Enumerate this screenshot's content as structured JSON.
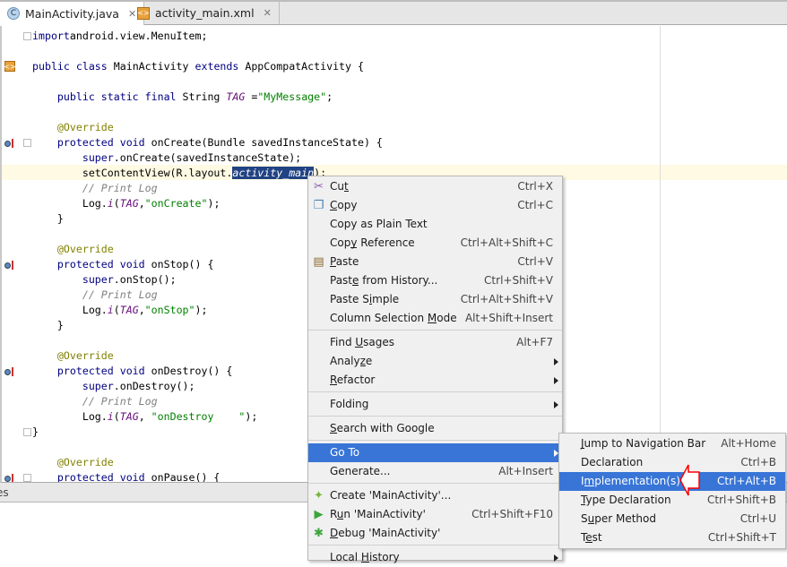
{
  "tabs": [
    {
      "label": "MainActivity.java",
      "icon": "java-class-icon",
      "active": true
    },
    {
      "label": "activity_main.xml",
      "icon": "xml-layout-icon",
      "active": false
    }
  ],
  "code": [
    {
      "row": 0,
      "t": [
        [
          "kw",
          "import"
        ],
        [
          "",
          "android.view.MenuItem;"
        ]
      ]
    },
    {
      "row": 2,
      "t": [
        [
          "kw",
          "public class "
        ],
        [
          "",
          "MainActivity "
        ],
        [
          "kw",
          "extends "
        ],
        [
          "",
          "AppCompatActivity {"
        ]
      ]
    },
    {
      "row": 4,
      "t": [
        [
          "",
          "    "
        ],
        [
          "kw",
          "public static final "
        ],
        [
          "",
          "String "
        ],
        [
          "tag",
          "TAG"
        ],
        [
          "",
          " ="
        ],
        [
          "str",
          "\"MyMessage\""
        ],
        [
          "",
          ";"
        ]
      ]
    },
    {
      "row": 6,
      "t": [
        [
          "",
          "    "
        ],
        [
          "ann",
          "@Override"
        ]
      ]
    },
    {
      "row": 7,
      "t": [
        [
          "",
          "    "
        ],
        [
          "kw",
          "protected void "
        ],
        [
          "",
          "onCreate(Bundle savedInstanceState) {"
        ]
      ]
    },
    {
      "row": 8,
      "t": [
        [
          "",
          "        "
        ],
        [
          "kw",
          "super"
        ],
        [
          "",
          ".onCreate(savedInstanceState);"
        ]
      ]
    },
    {
      "row": 9,
      "t": [
        [
          "",
          "        setContentView(R.layout."
        ],
        [
          "sel",
          "activity_main"
        ],
        [
          "",
          ");"
        ]
      ]
    },
    {
      "row": 10,
      "t": [
        [
          "",
          "        "
        ],
        [
          "cm",
          "// Print Log"
        ]
      ]
    },
    {
      "row": 11,
      "t": [
        [
          "",
          "        Log."
        ],
        [
          "tag",
          "i"
        ],
        [
          "",
          "("
        ],
        [
          "tag",
          "TAG"
        ],
        [
          "",
          ","
        ],
        [
          "str",
          "\"onCreate\""
        ],
        [
          "",
          ");"
        ]
      ]
    },
    {
      "row": 12,
      "t": [
        [
          "",
          "    }"
        ]
      ]
    },
    {
      "row": 14,
      "t": [
        [
          "",
          "    "
        ],
        [
          "ann",
          "@Override"
        ]
      ]
    },
    {
      "row": 15,
      "t": [
        [
          "",
          "    "
        ],
        [
          "kw",
          "protected void "
        ],
        [
          "",
          "onStop() {"
        ]
      ]
    },
    {
      "row": 16,
      "t": [
        [
          "",
          "        "
        ],
        [
          "kw",
          "super"
        ],
        [
          "",
          ".onStop();"
        ]
      ]
    },
    {
      "row": 17,
      "t": [
        [
          "",
          "        "
        ],
        [
          "cm",
          "// Print Log"
        ]
      ]
    },
    {
      "row": 18,
      "t": [
        [
          "",
          "        Log."
        ],
        [
          "tag",
          "i"
        ],
        [
          "",
          "("
        ],
        [
          "tag",
          "TAG"
        ],
        [
          "",
          ","
        ],
        [
          "str",
          "\"onStop\""
        ],
        [
          "",
          ");"
        ]
      ]
    },
    {
      "row": 19,
      "t": [
        [
          "",
          "    }"
        ]
      ]
    },
    {
      "row": 21,
      "t": [
        [
          "",
          "    "
        ],
        [
          "ann",
          "@Override"
        ]
      ]
    },
    {
      "row": 22,
      "t": [
        [
          "",
          "    "
        ],
        [
          "kw",
          "protected void "
        ],
        [
          "",
          "onDestroy() {"
        ]
      ]
    },
    {
      "row": 23,
      "t": [
        [
          "",
          "        "
        ],
        [
          "kw",
          "super"
        ],
        [
          "",
          ".onDestroy();"
        ]
      ]
    },
    {
      "row": 24,
      "t": [
        [
          "",
          "        "
        ],
        [
          "cm",
          "// Print Log"
        ]
      ]
    },
    {
      "row": 25,
      "t": [
        [
          "",
          "        Log."
        ],
        [
          "tag",
          "i"
        ],
        [
          "",
          "("
        ],
        [
          "tag",
          "TAG"
        ],
        [
          "",
          ", "
        ],
        [
          "str",
          "\"onDestroy    \""
        ],
        [
          "",
          ");"
        ]
      ]
    },
    {
      "row": 26,
      "t": [
        [
          "",
          "}"
        ]
      ]
    },
    {
      "row": 28,
      "t": [
        [
          "",
          "    "
        ],
        [
          "ann",
          "@Override"
        ]
      ]
    },
    {
      "row": 29,
      "t": [
        [
          "",
          "    "
        ],
        [
          "kw",
          "protected void "
        ],
        [
          "",
          "onPause() {"
        ]
      ]
    }
  ],
  "gutter": {
    "override_rows": [
      7,
      15,
      22,
      29
    ],
    "fold_rows": [
      0,
      7,
      26,
      29
    ],
    "layout_icon_row": 2
  },
  "status_strip": {
    "text": "es"
  },
  "context_menu": [
    {
      "label": "Cut",
      "mn": 2,
      "shortcut": "Ctrl+X",
      "icon": "scissors-icon"
    },
    {
      "label": "Copy",
      "mn": 0,
      "shortcut": "Ctrl+C",
      "icon": "copy-icon"
    },
    {
      "label": "Copy as Plain Text",
      "shortcut": ""
    },
    {
      "label": "Copy Reference",
      "mn": 3,
      "shortcut": "Ctrl+Alt+Shift+C"
    },
    {
      "label": "Paste",
      "mn": 0,
      "shortcut": "Ctrl+V",
      "icon": "paste-icon"
    },
    {
      "label": "Paste from History...",
      "mn": 4,
      "shortcut": "Ctrl+Shift+V"
    },
    {
      "label": "Paste Simple",
      "mn": 7,
      "shortcut": "Ctrl+Alt+Shift+V"
    },
    {
      "label": "Column Selection Mode",
      "mn": 17,
      "shortcut": "Alt+Shift+Insert"
    },
    {
      "sep": true
    },
    {
      "label": "Find Usages",
      "mn": 5,
      "shortcut": "Alt+F7"
    },
    {
      "label": "Analyze",
      "mn": 5,
      "submenu": true
    },
    {
      "label": "Refactor",
      "mn": 0,
      "submenu": true
    },
    {
      "sep": true
    },
    {
      "label": "Folding",
      "submenu": true
    },
    {
      "sep": true
    },
    {
      "label": "Search with Google",
      "mn": 0
    },
    {
      "sep": true
    },
    {
      "label": "Go To",
      "submenu": true,
      "highlighted": true
    },
    {
      "label": "Generate...",
      "shortcut": "Alt+Insert"
    },
    {
      "sep": true
    },
    {
      "label": "Create 'MainActivity'...",
      "icon": "android-icon"
    },
    {
      "label": "Run 'MainActivity'",
      "mn": 1,
      "shortcut": "Ctrl+Shift+F10",
      "icon": "run-icon"
    },
    {
      "label": "Debug 'MainActivity'",
      "mn": 0,
      "icon": "debug-icon"
    },
    {
      "sep": true
    },
    {
      "label": "Local History",
      "mn": 6,
      "submenu": true
    }
  ],
  "goto_submenu": [
    {
      "label": "Jump to Navigation Bar",
      "mn": 0,
      "shortcut": "Alt+Home"
    },
    {
      "label": "Declaration",
      "shortcut": "Ctrl+B"
    },
    {
      "label": "Implementation(s)",
      "mn": 1,
      "shortcut": "Ctrl+Alt+B",
      "highlighted": true
    },
    {
      "label": "Type Declaration",
      "mn": 0,
      "shortcut": "Ctrl+Shift+B"
    },
    {
      "label": "Super Method",
      "mn": 1,
      "shortcut": "Ctrl+U"
    },
    {
      "label": "Test",
      "mn": 1,
      "shortcut": "Ctrl+Shift+T"
    }
  ],
  "colors": {
    "highlight": "#3875d7",
    "selection": "#214283",
    "annotation_arrow": "#ff0000"
  }
}
